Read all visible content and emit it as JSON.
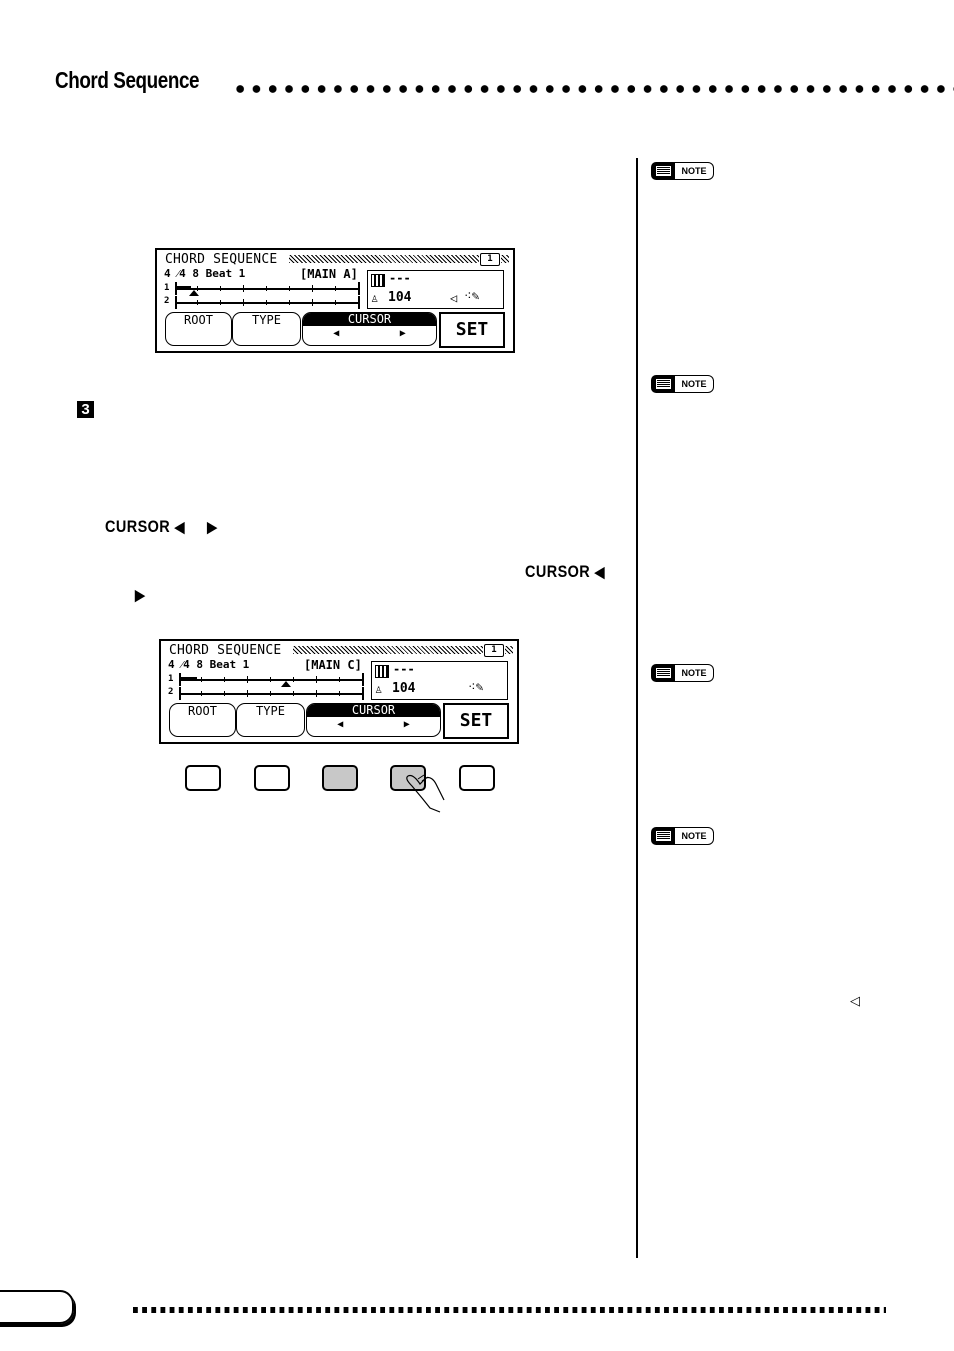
{
  "header": {
    "section_title": "Chord Sequence"
  },
  "step": {
    "number": "3",
    "cursor_ref_1": {
      "label": "CURSOR",
      "left_arrow": "◀",
      "right_arrow": "▶"
    },
    "cursor_ref_2": {
      "label": "CURSOR",
      "left_arrow": "◀",
      "right_arrow": "▶"
    }
  },
  "notes": [
    {
      "label": "NOTE",
      "icon": "note-icon"
    },
    {
      "label": "NOTE",
      "icon": "note-icon"
    },
    {
      "label": "NOTE",
      "icon": "note-icon"
    },
    {
      "label": "NOTE",
      "icon": "note-icon"
    }
  ],
  "sidebar_icon": "speaker-icon",
  "lcd_screens": [
    {
      "title": "CHORD SEQUENCE",
      "page": "1",
      "meter": "4 ⁄4 8 Beat 1",
      "section": "[MAIN A]",
      "chord": "---",
      "tempo": "104",
      "show_speaker": true,
      "cursor_position_bar": 1,
      "buttons": {
        "root": "ROOT",
        "type": "TYPE",
        "cursor": "CURSOR",
        "left": "◀",
        "right": "▶",
        "set": "SET"
      }
    },
    {
      "title": "CHORD SEQUENCE",
      "page": "1",
      "meter": "4 ⁄4 8 Beat 1",
      "section": "[MAIN C]",
      "chord": "---",
      "tempo": "104",
      "show_speaker": false,
      "cursor_position_bar": 5,
      "buttons": {
        "root": "ROOT",
        "type": "TYPE",
        "cursor": "CURSOR",
        "left": "◀",
        "right": "▶",
        "set": "SET"
      }
    }
  ],
  "panel_buttons": [
    {
      "name": "panel-button-1",
      "pressed": false
    },
    {
      "name": "panel-button-2",
      "pressed": false
    },
    {
      "name": "panel-button-3",
      "pressed": true
    },
    {
      "name": "panel-button-4",
      "pressed": true,
      "finger": true
    },
    {
      "name": "panel-button-5",
      "pressed": false
    }
  ]
}
